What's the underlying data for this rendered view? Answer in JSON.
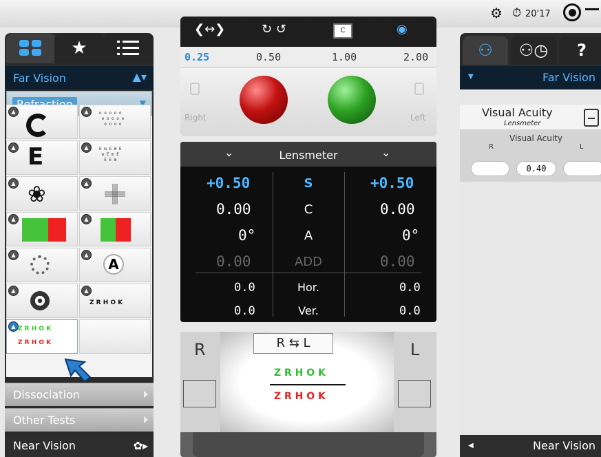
{
  "status": {
    "timer": "20'17"
  },
  "left_panel": {
    "section": "Far Vision",
    "subsection": "Refraction",
    "chart_rows": [
      {
        "cells": [
          "landolt-c",
          "landolt-rows"
        ]
      },
      {
        "cells": [
          "tumbling-e",
          "e-rows"
        ]
      },
      {
        "cells": [
          "butterfly",
          "cross-grid"
        ]
      },
      {
        "cells": [
          "red-green-test",
          "red-green-dots"
        ]
      },
      {
        "cells": [
          "dot-circle",
          "letter-a-circle"
        ]
      },
      {
        "cells": [
          "fixation-ring",
          "zrhok-line"
        ]
      },
      {
        "cells": [
          "red-green-zrhok",
          "empty"
        ]
      }
    ],
    "cell_text": {
      "letter_e": "E",
      "letter_a": "A",
      "zrhok": "Z R H O K"
    },
    "menu": [
      {
        "label": "Dissociation"
      },
      {
        "label": "Other Tests"
      }
    ],
    "near_label": "Near Vision"
  },
  "center": {
    "steps": [
      "0.25",
      "0.50",
      "1.00",
      "2.00"
    ],
    "active_step": "0.25",
    "right_label": "Right",
    "left_label": "Left",
    "lensmeter": {
      "title": "Lensmeter",
      "rows": [
        {
          "r": "+0.50",
          "label": "S",
          "l": "+0.50"
        },
        {
          "r": "0.00",
          "label": "C",
          "l": "0.00"
        },
        {
          "r": "0°",
          "label": "A",
          "l": "0°"
        },
        {
          "r": "0.00",
          "label": "ADD",
          "l": "0.00"
        },
        {
          "r": "0.0",
          "label": "Hor.",
          "l": "0.0"
        },
        {
          "r": "0.0",
          "label": "Ver.",
          "l": "0.0"
        }
      ]
    },
    "preview": {
      "r": "R",
      "l": "L",
      "swap": "R ⇆ L",
      "line1": "Z R H O K",
      "line2": "Z R H O K"
    }
  },
  "right_panel": {
    "section": "Far Vision",
    "va_title": "Visual Acuity",
    "va_subtitle": "Lensmeter",
    "table_title": "Visual Acuity",
    "col_r": "R",
    "col_l": "L",
    "value": "0.40",
    "near_label": "Near Vision",
    "help": "?"
  }
}
